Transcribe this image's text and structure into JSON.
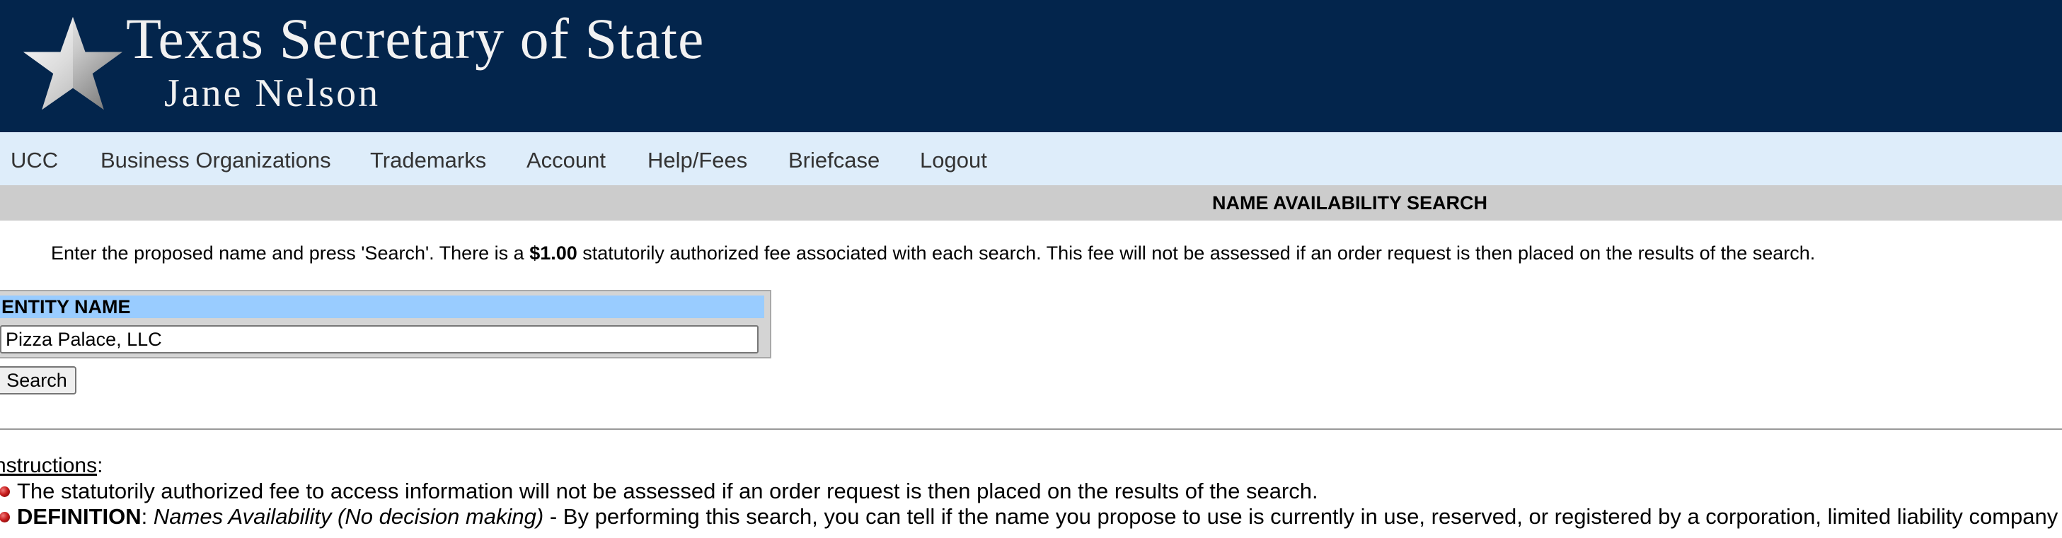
{
  "banner": {
    "title": "Texas Secretary of State",
    "subtitle": "Jane Nelson",
    "logo_icon": "star-icon",
    "background_color": "#03254c"
  },
  "nav": {
    "items": [
      {
        "label": "UCC"
      },
      {
        "label": "Business Organizations"
      },
      {
        "label": "Trademarks"
      },
      {
        "label": "Account"
      },
      {
        "label": "Help/Fees"
      },
      {
        "label": "Briefcase"
      },
      {
        "label": "Logout"
      }
    ],
    "background_color": "#deedfa"
  },
  "page": {
    "title": "NAME AVAILABILITY SEARCH"
  },
  "intro": {
    "before": "Enter the proposed name and press 'Search'. There is a ",
    "fee": "$1.00",
    "after": " statutorily authorized fee associated with each search. This fee will not be assessed if an order request is then placed on the results of the search."
  },
  "form": {
    "entity_label": "ENTITY NAME",
    "entity_value": "Pizza Palace, LLC",
    "search_label": "Search",
    "header_color": "#99ccff"
  },
  "instructions": {
    "heading": "nstructions",
    "colon": ":",
    "item1": "The statutorily authorized fee to access information will not be assessed if an order request is then placed on the results of the search.",
    "item2_term": "DEFINITION",
    "item2_sep": ": ",
    "item2_italic": "Names Availability (No decision making)",
    "item2_rest": " - By performing this search, you can tell if the name you propose to use is currently in use, reserved, or registered by a corporation, limited liability company",
    "bullet_icon": "red-bullet-icon"
  }
}
